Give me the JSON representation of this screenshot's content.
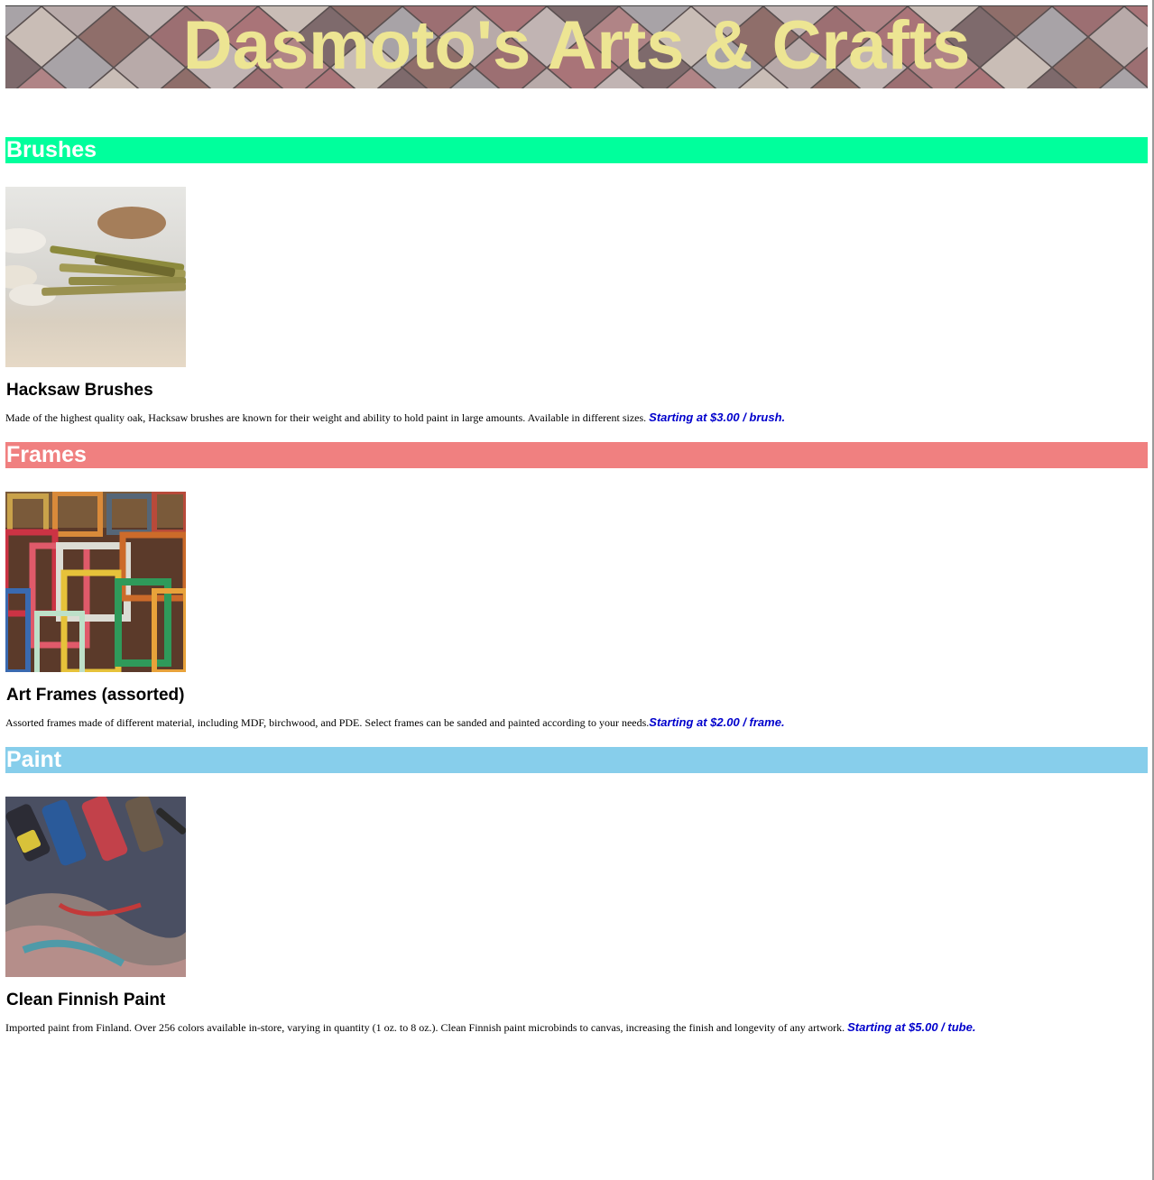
{
  "header": {
    "title": "Dasmoto's Arts & Crafts"
  },
  "sections": [
    {
      "heading": "Brushes",
      "color": "#00ff9c",
      "product_title": "Hacksaw Brushes",
      "description": "Made of the highest quality oak, Hacksaw brushes are known for their weight and ability to hold paint in large amounts. Available in different sizes.",
      "price": "Starting at $3.00 / brush.",
      "image_icon": "brushes-photo"
    },
    {
      "heading": "Frames",
      "color": "#f08080",
      "product_title": "Art Frames (assorted)",
      "description": "Assorted frames made of different material, including MDF, birchwood, and PDE. Select frames can be sanded and painted according to your needs.",
      "price": "Starting at $2.00 / frame.",
      "image_icon": "frames-photo"
    },
    {
      "heading": "Paint",
      "color": "#87ceeb",
      "product_title": "Clean Finnish Paint",
      "description": "Imported paint from Finland. Over 256 colors available in-store, varying in quantity (1 oz. to 8 oz.). Clean Finnish paint microbinds to canvas, increasing the finish and longevity of any artwork.",
      "price": "Starting at $5.00 / tube.",
      "image_icon": "paint-photo"
    }
  ],
  "colors": {
    "title_text": "#ede593",
    "price_text": "#0000cc"
  }
}
